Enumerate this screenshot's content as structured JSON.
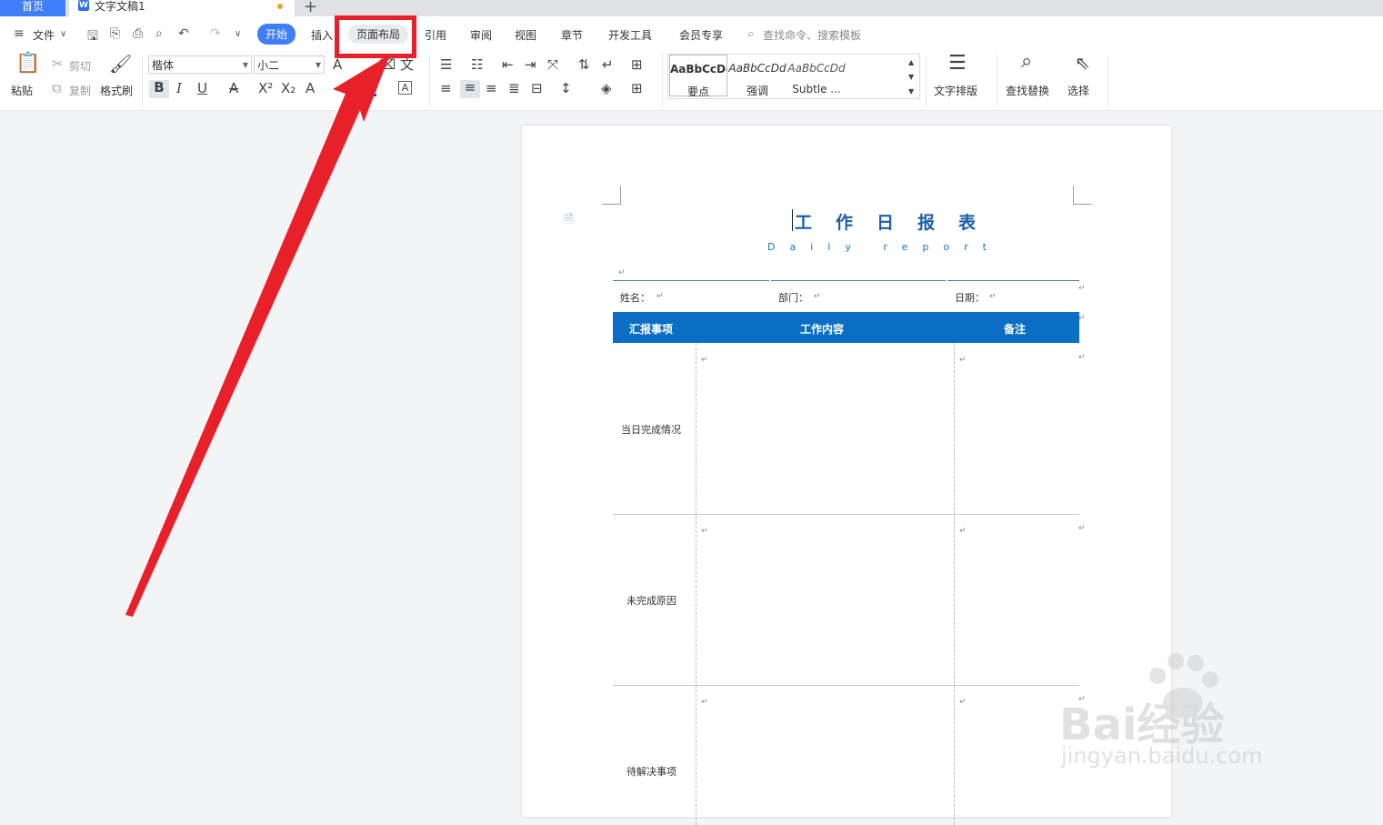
{
  "tabs": {
    "home": "首页",
    "doc": "文字文稿1",
    "add": "+"
  },
  "menu": {
    "file": "文件",
    "items": [
      "开始",
      "插入",
      "页面布局",
      "引用",
      "审阅",
      "视图",
      "章节",
      "开发工具",
      "会员专享"
    ],
    "search_placeholder": "查找命令、搜索模板"
  },
  "ribbon": {
    "paste": "粘贴",
    "cut": "剪切",
    "copy": "复制",
    "format_painter": "格式刷",
    "font_name": "楷体",
    "font_size": "小二",
    "styles": [
      {
        "sample": "AaBbCcDd",
        "name": "要点"
      },
      {
        "sample": "AaBbCcDd",
        "name": "强调"
      },
      {
        "sample": "AaBbCcDd",
        "name": "Subtle ..."
      }
    ],
    "text_layout": "文字排版",
    "find_replace": "查找替换",
    "select": "选择"
  },
  "document": {
    "title": "工作日报表",
    "subtitle": "Daily report",
    "fields": {
      "name": "姓名：",
      "dept": "部门：",
      "date": "日期："
    },
    "headers": [
      "汇报事项",
      "工作内容",
      "备注"
    ],
    "rows": [
      "当日完成情况",
      "未完成原因",
      "待解决事项"
    ]
  },
  "watermark": {
    "brand": "Bai经验",
    "url": "jingyan.baidu.com"
  },
  "colors": {
    "accent": "#3f7ef7",
    "table_header": "#0a6fc4",
    "annotation": "#e8202a"
  }
}
